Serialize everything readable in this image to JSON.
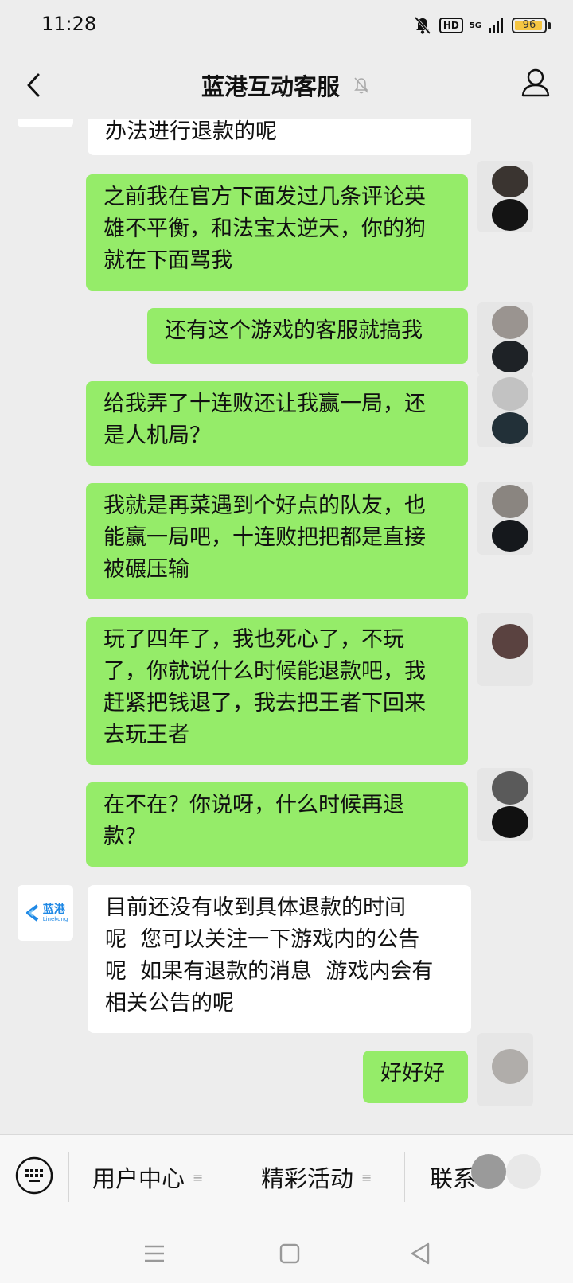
{
  "status_bar": {
    "time": "11:28",
    "hd": "HD",
    "network": "5G",
    "battery": "96",
    "battery_level": 0.96,
    "icons": [
      "mute-bell-icon",
      "signal-icon",
      "battery-icon"
    ]
  },
  "header": {
    "title": "蓝港互动客服",
    "icons": [
      "back-arrow-icon",
      "muted-bell-icon",
      "profile-icon"
    ]
  },
  "messages": [
    {
      "from": "service",
      "text": "办法进行退款的呢"
    },
    {
      "from": "me",
      "text": "之前我在官方下面发过几条评论英\n雄不平衡，和法宝太逆天，你的狗\n就在下面骂我"
    },
    {
      "from": "me",
      "text": "还有这个游戏的客服就搞我"
    },
    {
      "from": "me",
      "text": "给我弄了十连败还让我赢一局，还\n是人机局？"
    },
    {
      "from": "me",
      "text": "我就是再菜遇到个好点的队友，也\n能赢一局吧，十连败把把都是直接\n被碾压输"
    },
    {
      "from": "me",
      "text": "玩了四年了，我也死心了，不玩\n了，你就说什么时候能退款吧，我\n赶紧把钱退了，我去把王者下回来\n去玩王者"
    },
    {
      "from": "me",
      "text": "在不在？你说呀，什么时候再退\n款？"
    },
    {
      "from": "service",
      "text": "目前还没有收到具体退款的时间\n呢  您可以关注一下游戏内的公告\n呢  如果有退款的消息  游戏内会有\n相关公告的呢"
    },
    {
      "from": "me",
      "text": "好好好"
    }
  ],
  "service_avatar": {
    "logo_text": "蓝港",
    "logo_sub": "Linekong",
    "brand_color": "#1e88e5"
  },
  "bottom_menu": {
    "items": [
      {
        "label": "用户中心"
      },
      {
        "label": "精彩活动"
      },
      {
        "label": "联系"
      }
    ],
    "icons": [
      "keyboard-icon",
      "menu-dots-icon"
    ]
  },
  "nav": {
    "icons": [
      "menu-icon",
      "home-square-icon",
      "back-triangle-icon"
    ]
  },
  "colors": {
    "outgoing_bubble": "#95ec69",
    "incoming_bubble": "#ffffff",
    "background": "#ededed"
  }
}
